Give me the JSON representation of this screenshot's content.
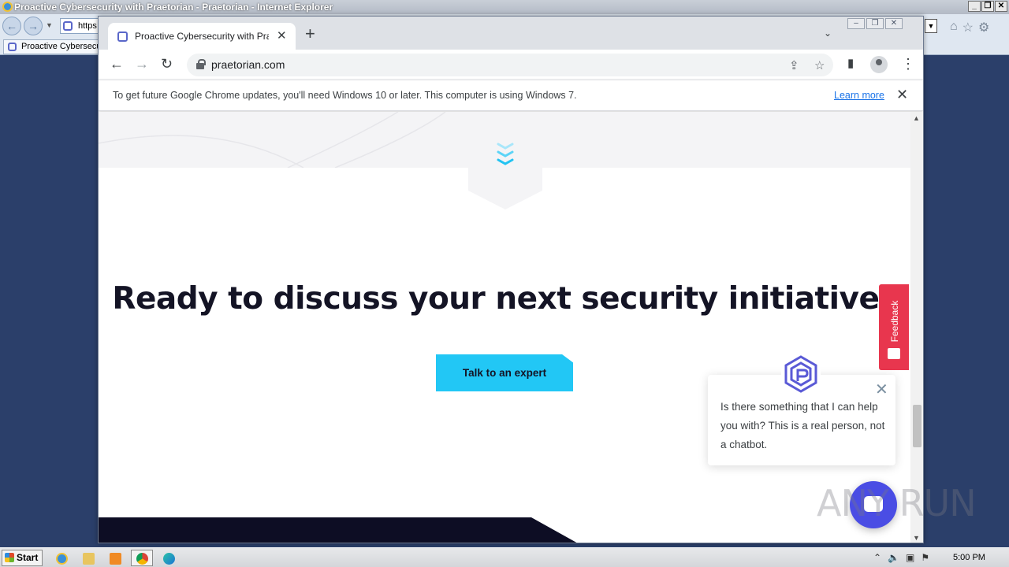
{
  "ie": {
    "title": "Proactive Cybersecurity with Praetorian - Praetorian - Internet Explorer",
    "address_value": "https",
    "tab_label": "Proactive Cybersecu"
  },
  "chrome": {
    "tab_title": "Proactive Cybersecurity with Praetori",
    "url": "praetorian.com",
    "infobar": {
      "message": "To get future Google Chrome updates, you'll need Windows 10 or later. This computer is using Windows 7.",
      "link": "Learn more"
    }
  },
  "page": {
    "headline": "Ready to discuss your next security initiative?",
    "cta_label": "Talk to an expert",
    "feedback_label": "Feedback",
    "chat_message": "Is there something that I can help you with? This is a real person, not a chatbot.",
    "colors": {
      "accent": "#22c7f5",
      "dark": "#141425",
      "feedback": "#e8364e",
      "chat": "#4a4de4"
    }
  },
  "watermark": "ANY RUN",
  "taskbar": {
    "start_label": "Start",
    "clock": "5:00 PM"
  }
}
